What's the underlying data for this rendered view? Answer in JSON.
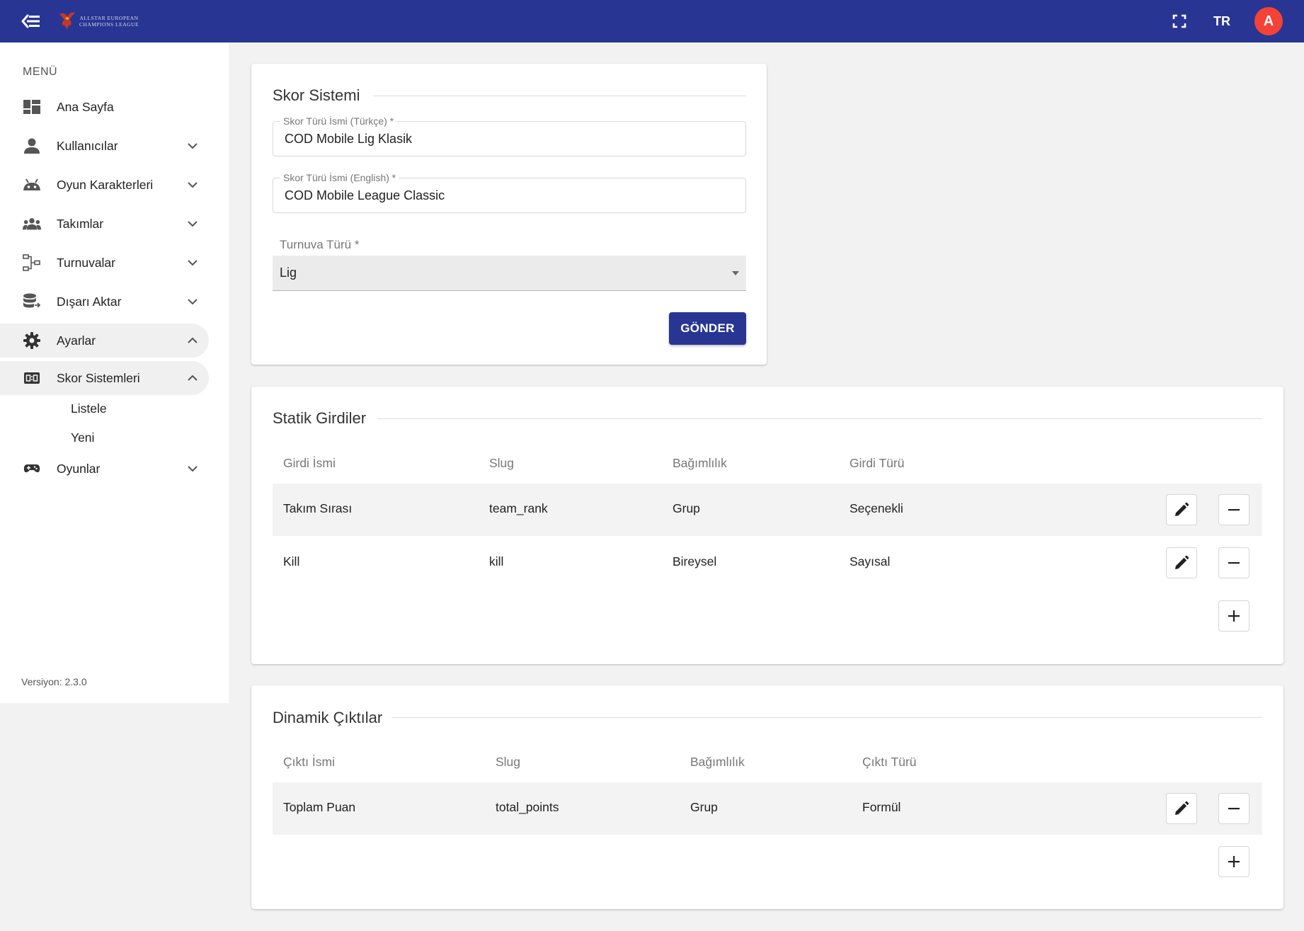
{
  "topbar": {
    "logo_line1": "ALLSTAR EUROPEAN",
    "logo_line2": "CHAMPIONS LEAGUE",
    "language": "TR",
    "avatar_initial": "A",
    "bar_color": "#283593",
    "avatar_color": "#f44336"
  },
  "sidebar": {
    "heading": "MENÜ",
    "items": [
      {
        "label": "Ana Sayfa",
        "icon": "dashboard-icon"
      },
      {
        "label": "Kullanıcılar",
        "icon": "person-icon"
      },
      {
        "label": "Oyun Karakterleri",
        "icon": "android-icon"
      },
      {
        "label": "Takımlar",
        "icon": "group-icon"
      },
      {
        "label": "Turnuvalar",
        "icon": "bracket-icon"
      },
      {
        "label": "Dışarı Aktar",
        "icon": "database-export-icon"
      },
      {
        "label": "Ayarlar",
        "icon": "gear-icon"
      },
      {
        "label": "Skor Sistemleri",
        "icon": "scoreboard-icon"
      },
      {
        "label": "Oyunlar",
        "icon": "gamepad-icon"
      }
    ],
    "sub_items": [
      "Listele",
      "Yeni"
    ],
    "version": "Versiyon: 2.3.0"
  },
  "score_system": {
    "title": "Skor Sistemi",
    "name_tr_label": "Skor Türü İsmi (Türkçe) *",
    "name_tr_value": "COD Mobile Lig Klasik",
    "name_en_label": "Skor Türü İsmi (English) *",
    "name_en_value": "COD Mobile League Classic",
    "tournament_type_label": "Turnuva Türü *",
    "tournament_type_value": "Lig",
    "submit_label": "GÖNDER"
  },
  "static_inputs": {
    "title": "Statik Girdiler",
    "headers": [
      "Girdi İsmi",
      "Slug",
      "Bağımlılık",
      "Girdi Türü"
    ],
    "rows": [
      {
        "name": "Takım Sırası",
        "slug": "team_rank",
        "dependency": "Grup",
        "type": "Seçenekli"
      },
      {
        "name": "Kill",
        "slug": "kill",
        "dependency": "Bireysel",
        "type": "Sayısal"
      }
    ]
  },
  "dynamic_outputs": {
    "title": "Dinamik Çıktılar",
    "headers": [
      "Çıktı İsmi",
      "Slug",
      "Bağımlılık",
      "Çıktı Türü"
    ],
    "rows": [
      {
        "name": "Toplam Puan",
        "slug": "total_points",
        "dependency": "Grup",
        "type": "Formül"
      }
    ]
  }
}
